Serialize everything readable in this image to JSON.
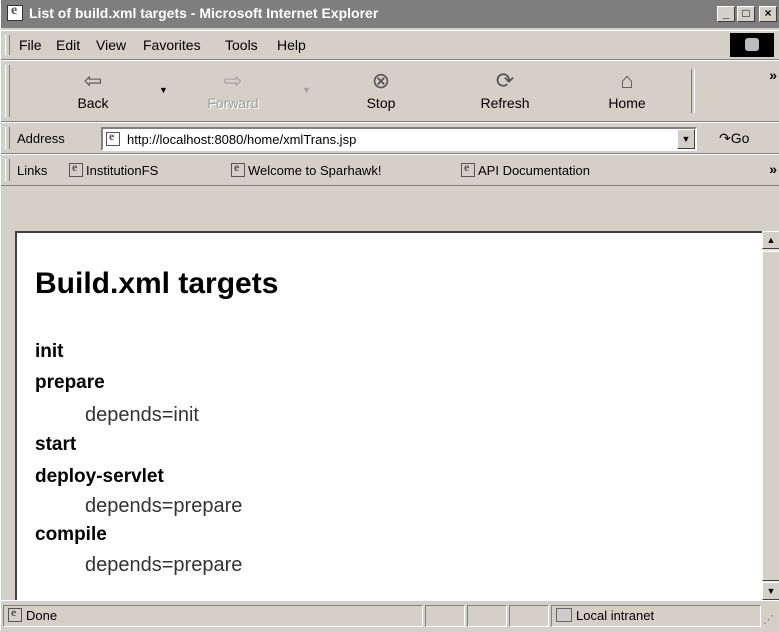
{
  "window": {
    "title": "List of build.xml targets - Microsoft Internet Explorer",
    "controls": {
      "minimize": "_",
      "maximize": "□",
      "close": "×"
    }
  },
  "menu": [
    "File",
    "Edit",
    "View",
    "Favorites",
    "Tools",
    "Help"
  ],
  "toolbar": {
    "back": "Back",
    "forward": "Forward",
    "stop": "Stop",
    "refresh": "Refresh",
    "home": "Home",
    "more": "»"
  },
  "address": {
    "label": "Address",
    "url": "http://localhost:8080/home/xmlTrans.jsp",
    "go": "Go"
  },
  "links": {
    "label": "Links",
    "items": [
      "InstitutionFS",
      "Welcome to Sparhawk!",
      "API Documentation"
    ],
    "more": "»"
  },
  "page": {
    "heading": "Build.xml targets",
    "targets": [
      {
        "name": "init"
      },
      {
        "name": "prepare",
        "depends": "depends=init"
      },
      {
        "name": "start"
      },
      {
        "name": "deploy-servlet",
        "depends": "depends=prepare"
      },
      {
        "name": "compile",
        "depends": "depends=prepare"
      }
    ]
  },
  "status": {
    "text": "Done",
    "zone": "Local intranet"
  }
}
